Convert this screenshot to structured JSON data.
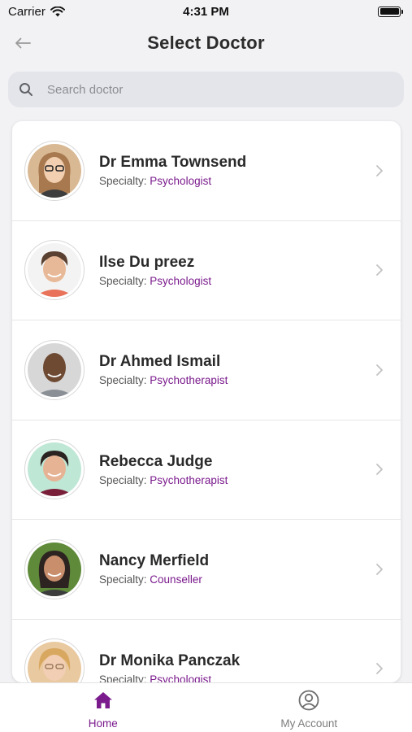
{
  "status_bar": {
    "carrier": "Carrier",
    "time": "4:31 PM"
  },
  "header": {
    "title": "Select Doctor",
    "back_icon": "arrow-left-icon"
  },
  "search": {
    "placeholder": "Search doctor",
    "value": ""
  },
  "colors": {
    "accent": "#7a1a8c",
    "background": "#f2f2f4",
    "search_bg": "#e4e5ea"
  },
  "doctors": [
    {
      "name": "Dr Emma Townsend",
      "specialty_label": "Specialty:",
      "specialty": "Psychologist"
    },
    {
      "name": "Ilse Du preez",
      "specialty_label": "Specialty:",
      "specialty": "Psychologist"
    },
    {
      "name": "Dr Ahmed Ismail",
      "specialty_label": "Specialty:",
      "specialty": "Psychotherapist"
    },
    {
      "name": "Rebecca Judge",
      "specialty_label": "Specialty:",
      "specialty": "Psychotherapist"
    },
    {
      "name": "Nancy Merfield",
      "specialty_label": "Specialty:",
      "specialty": "Counseller"
    },
    {
      "name": "Dr Monika Panczak",
      "specialty_label": "Specialty:",
      "specialty": "Psychologist"
    }
  ],
  "tabs": [
    {
      "label": "Home",
      "icon": "home-icon",
      "active": true
    },
    {
      "label": "My Account",
      "icon": "user-circle-icon",
      "active": false
    }
  ]
}
